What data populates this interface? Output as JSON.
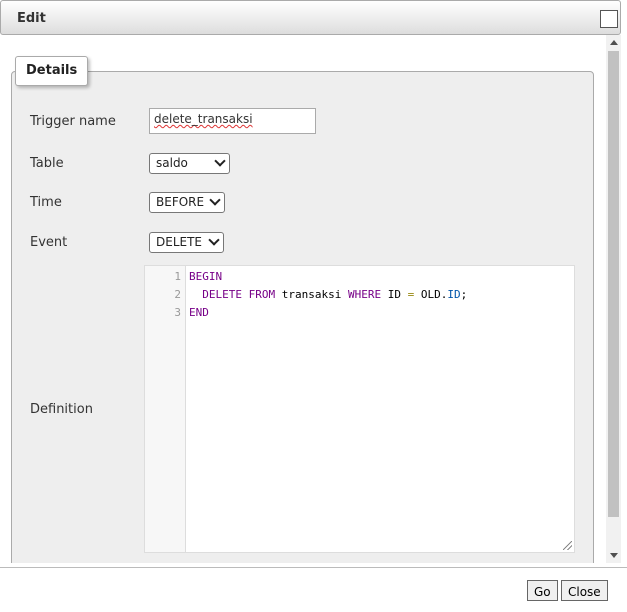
{
  "dialog": {
    "title": "Edit"
  },
  "form": {
    "legend": "Details",
    "trigger_name_label": "Trigger name",
    "trigger_name_value": "delete_transaksi",
    "table_label": "Table",
    "table_value": "saldo",
    "time_label": "Time",
    "time_value": "BEFORE",
    "event_label": "Event",
    "event_value": "DELETE",
    "definition_label": "Definition"
  },
  "editor": {
    "line_numbers": [
      "1",
      "2",
      "3"
    ],
    "tokens": {
      "begin": "BEGIN",
      "indent": "  ",
      "delete": "DELETE",
      "from": "FROM",
      "table": "transaksi",
      "where": "WHERE",
      "col": "ID",
      "eq": "=",
      "old": "OLD",
      "dot": ".",
      "old_col": "ID",
      "semicolon": ";",
      "end": "END"
    }
  },
  "footer": {
    "go_label": "Go",
    "close_label": "Close"
  }
}
